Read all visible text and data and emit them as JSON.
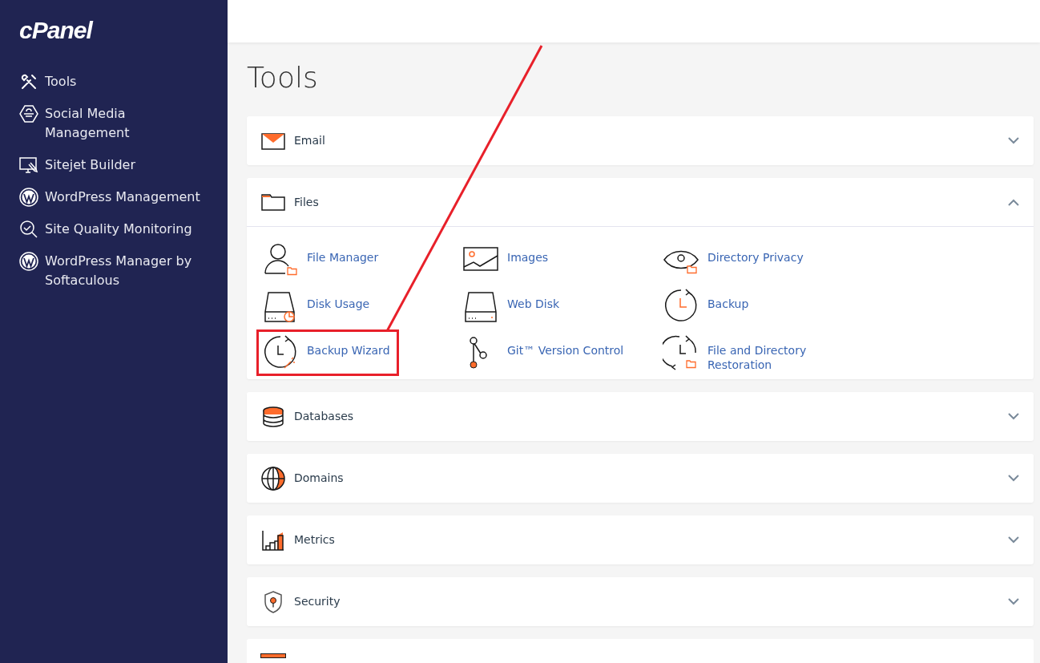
{
  "sidebar": {
    "logo": "cPanel",
    "items": [
      {
        "label": "Tools",
        "selected": false
      },
      {
        "label": "Social Media Management",
        "selected": false
      },
      {
        "label": "Sitejet Builder",
        "selected": false
      },
      {
        "label": "WordPress Management",
        "selected": false
      },
      {
        "label": "Site Quality Monitoring",
        "selected": false
      },
      {
        "label": "WordPress Manager by Softaculous",
        "selected": false
      }
    ]
  },
  "page": {
    "title": "Tools"
  },
  "sections": [
    {
      "title": "Email",
      "expanded": false
    },
    {
      "title": "Files",
      "expanded": true,
      "tools": [
        {
          "label": "File Manager",
          "highlighted": false
        },
        {
          "label": "Images",
          "highlighted": false
        },
        {
          "label": "Directory Privacy",
          "highlighted": false
        },
        {
          "label": "Disk Usage",
          "highlighted": false
        },
        {
          "label": "Web Disk",
          "highlighted": false
        },
        {
          "label": "Backup",
          "highlighted": false
        },
        {
          "label": "Backup Wizard",
          "highlighted": true
        },
        {
          "label": "Git™ Version Control",
          "highlighted": false
        },
        {
          "label": "File and Directory Restoration",
          "highlighted": false
        }
      ]
    },
    {
      "title": "Databases",
      "expanded": false
    },
    {
      "title": "Domains",
      "expanded": false
    },
    {
      "title": "Metrics",
      "expanded": false
    },
    {
      "title": "Security",
      "expanded": false
    }
  ]
}
